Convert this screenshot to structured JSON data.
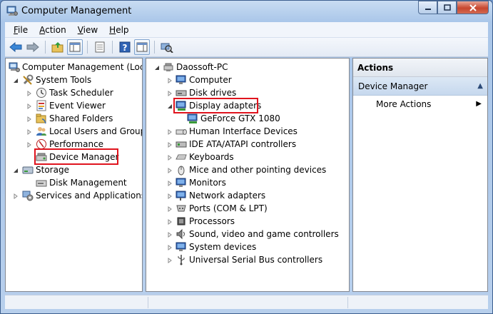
{
  "window": {
    "title": "Computer Management"
  },
  "menu": [
    {
      "label": "File",
      "key": "F",
      "rest": "ile"
    },
    {
      "label": "Action",
      "key": "A",
      "rest": "ction"
    },
    {
      "label": "View",
      "key": "V",
      "rest": "iew"
    },
    {
      "label": "Help",
      "key": "H",
      "rest": "elp"
    }
  ],
  "toolbar": {
    "buttons": [
      "back-icon",
      "forward-icon",
      "up-folder-icon",
      "show-hide-tree-icon",
      "properties-icon",
      "help-icon",
      "show-hide-action-pane-icon",
      "scan-hardware-icon"
    ]
  },
  "left_tree": {
    "root": "Computer Management (Local",
    "system_tools": "System Tools",
    "task_scheduler": "Task Scheduler",
    "event_viewer": "Event Viewer",
    "shared_folders": "Shared Folders",
    "local_users": "Local Users and Groups",
    "performance": "Performance",
    "device_manager": "Device Manager",
    "storage": "Storage",
    "disk_management": "Disk Management",
    "services": "Services and Applications"
  },
  "device_tree": {
    "root": "Daossoft-PC",
    "computer": "Computer",
    "disk_drives": "Disk drives",
    "display_adapters": "Display adapters",
    "gpu": "GeForce GTX 1080",
    "hid": "Human Interface Devices",
    "ide": "IDE ATA/ATAPI controllers",
    "keyboards": "Keyboards",
    "mice": "Mice and other pointing devices",
    "monitors": "Monitors",
    "network": "Network adapters",
    "ports": "Ports (COM & LPT)",
    "processors": "Processors",
    "sound": "Sound, video and game controllers",
    "system_devices": "System devices",
    "usb": "Universal Serial Bus controllers"
  },
  "actions": {
    "title": "Actions",
    "section": "Device Manager",
    "more": "More Actions"
  },
  "colors": {
    "highlight": "#e0141e",
    "close": "#c7462e"
  }
}
